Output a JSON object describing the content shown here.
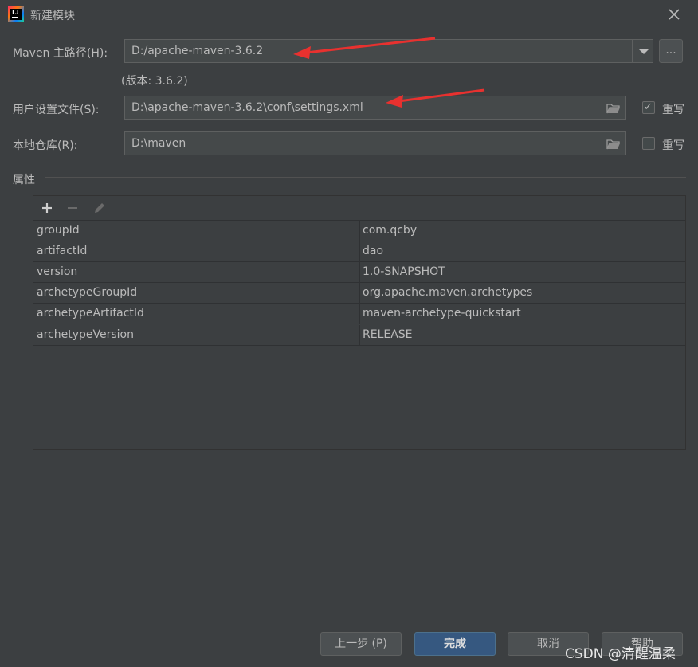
{
  "window": {
    "title": "新建模块"
  },
  "maven_home": {
    "label": "Maven 主路径(H):",
    "value": "D:/apache-maven-3.6.2",
    "browse_label": "...",
    "version_text": "(版本: 3.6.2)"
  },
  "user_settings": {
    "label": "用户设置文件(S):",
    "value": "D:\\apache-maven-3.6.2\\conf\\settings.xml",
    "override_label": "重写",
    "override_checked": true
  },
  "local_repo": {
    "label": "本地仓库(R):",
    "value": "D:\\maven",
    "override_label": "重写",
    "override_checked": false
  },
  "properties": {
    "section_label": "属性",
    "rows": [
      {
        "key": "groupId",
        "value": "com.qcby"
      },
      {
        "key": "artifactId",
        "value": "dao"
      },
      {
        "key": "version",
        "value": "1.0-SNAPSHOT"
      },
      {
        "key": "archetypeGroupId",
        "value": "org.apache.maven.archetypes"
      },
      {
        "key": "archetypeArtifactId",
        "value": "maven-archetype-quickstart"
      },
      {
        "key": "archetypeVersion",
        "value": "RELEASE"
      }
    ]
  },
  "buttons": {
    "previous": "上一步 (P)",
    "finish": "完成",
    "cancel": "取消",
    "help": "帮助"
  },
  "watermark": "CSDN @清醒温柔",
  "colors": {
    "background": "#3c3f41",
    "field": "#45494a",
    "primary": "#365880",
    "arrow": "#e8312f"
  }
}
